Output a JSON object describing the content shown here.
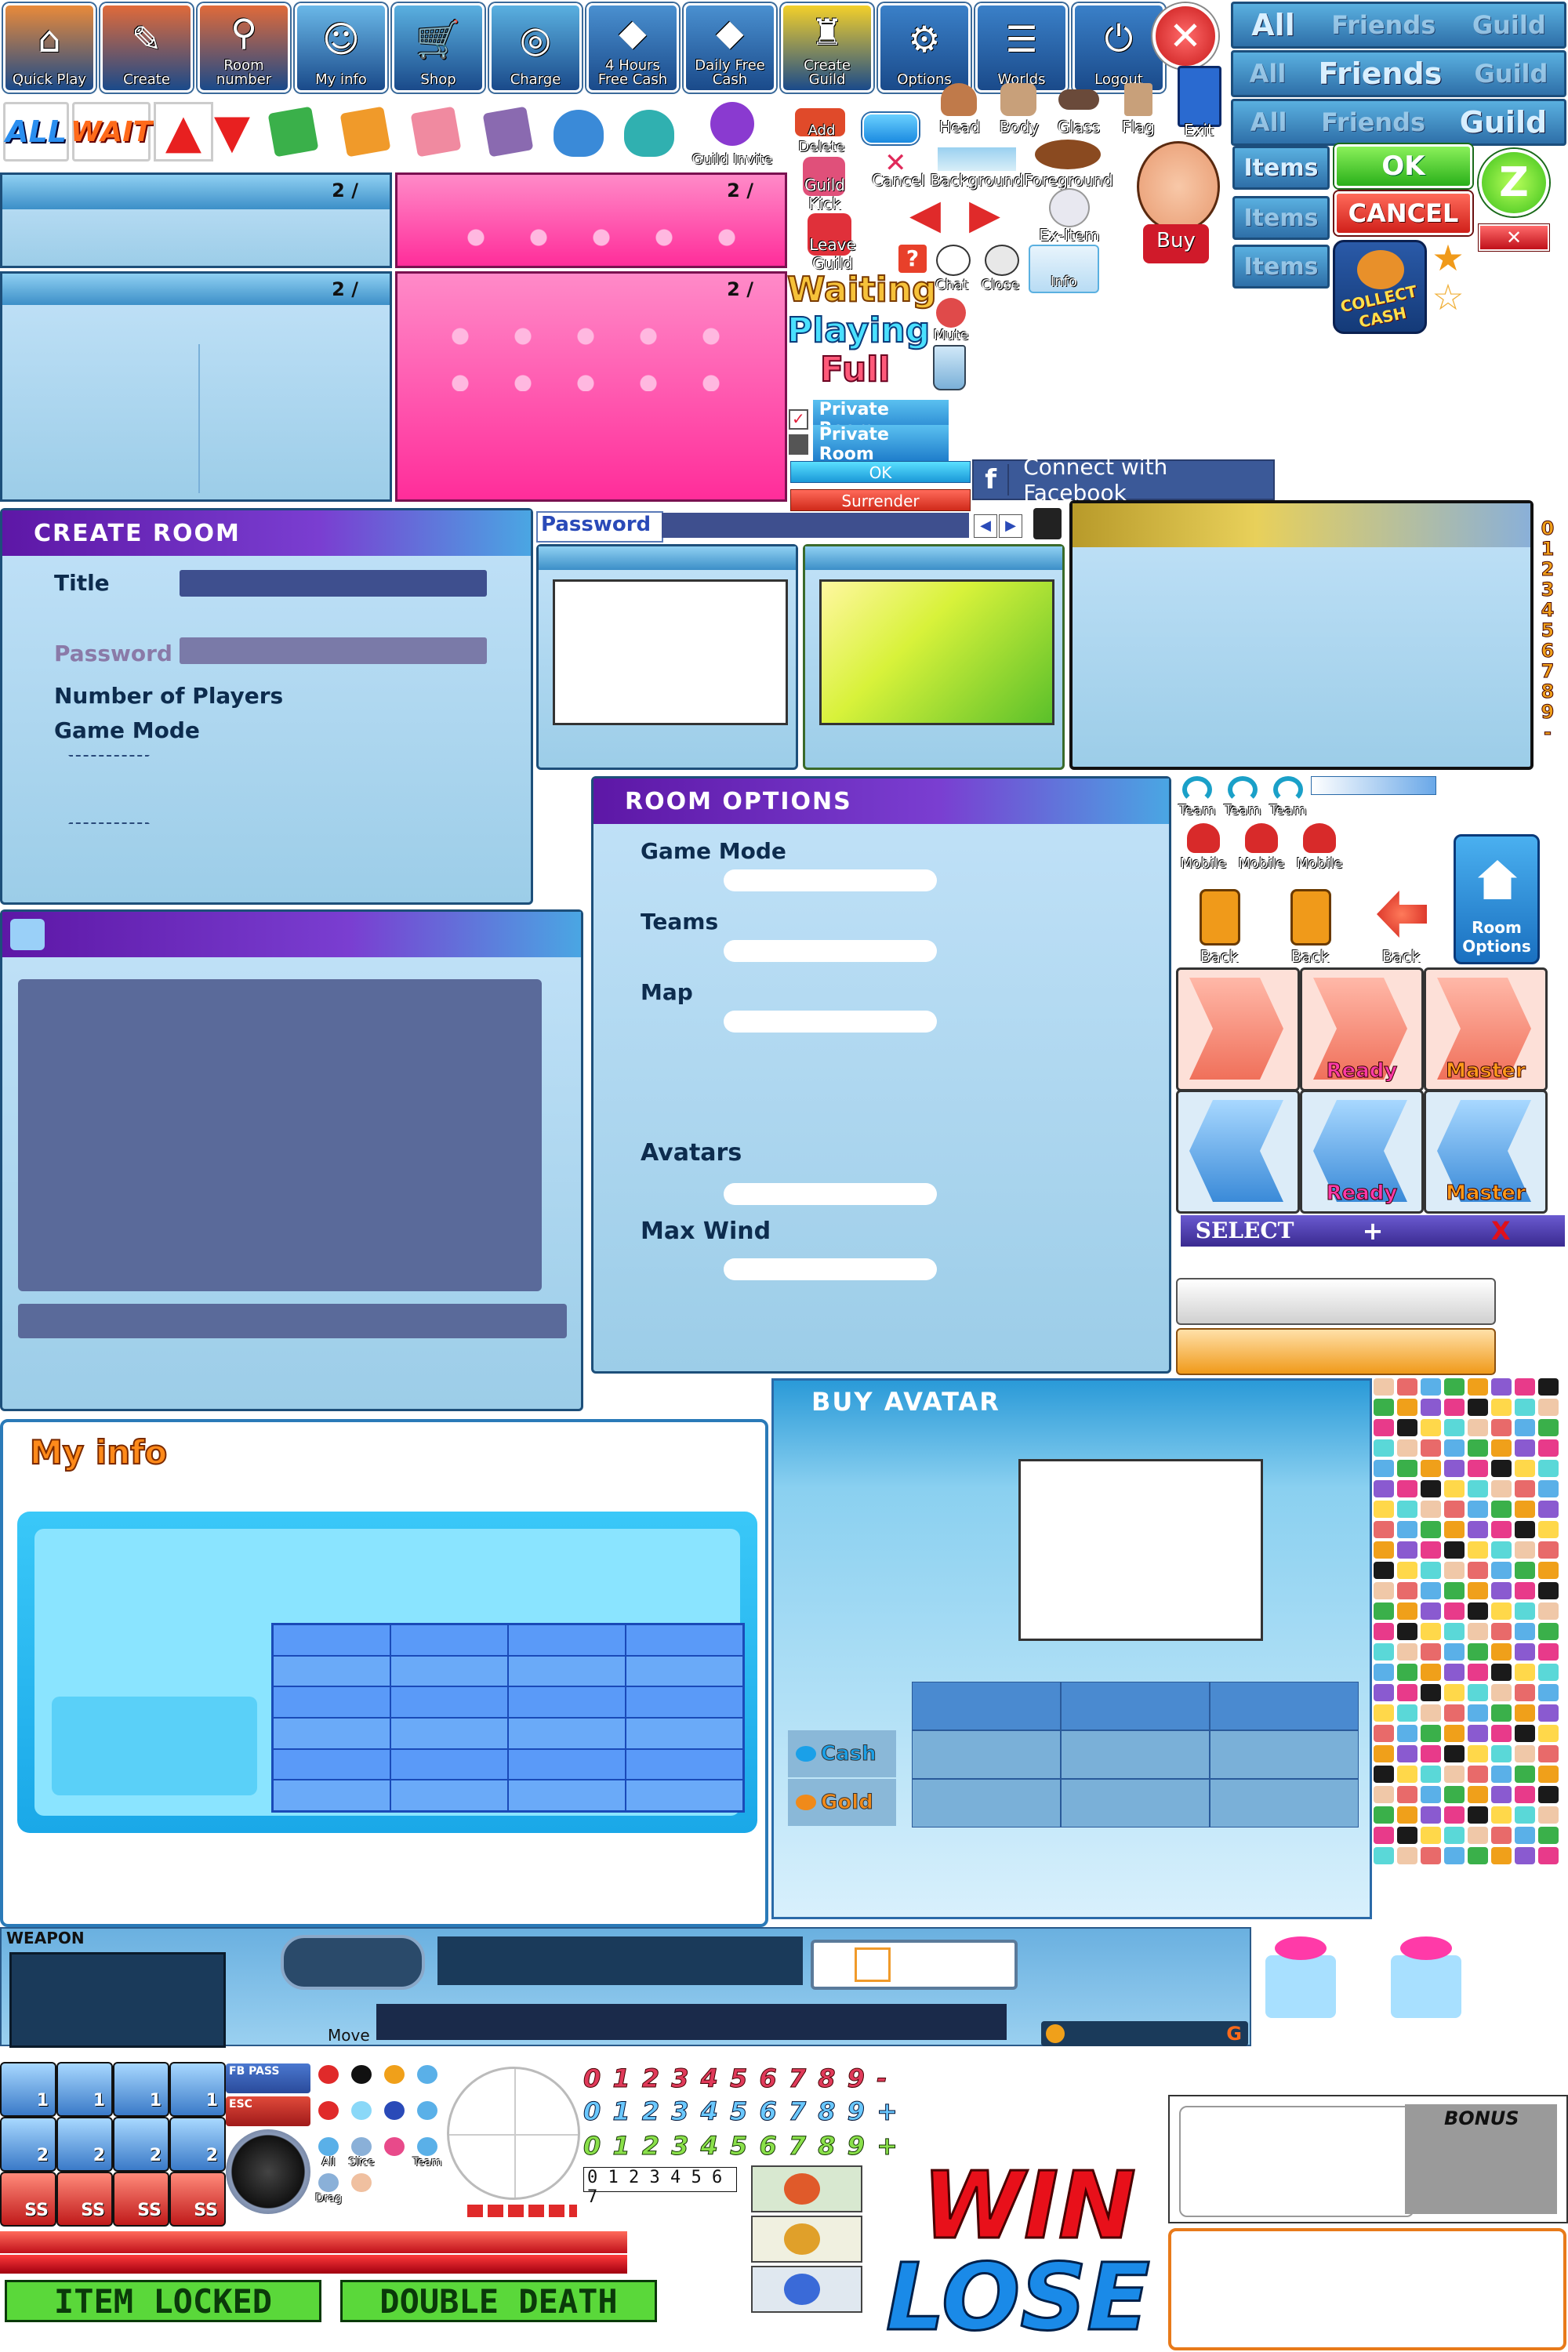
{
  "toolbar": [
    {
      "label": "Quick Play",
      "icon": "house-icon",
      "color": "#e98a3a"
    },
    {
      "label": "Create",
      "icon": "pencil-house-icon",
      "color": "#e06a3a"
    },
    {
      "label": "Room number",
      "icon": "magnifier-house-icon",
      "color": "#e06a3a"
    },
    {
      "label": "My info",
      "icon": "ghost-face-icon",
      "color": "#6ab8e8"
    },
    {
      "label": "Shop",
      "icon": "cart-icon",
      "color": "#5ab0e0"
    },
    {
      "label": "Charge",
      "icon": "coin-stack-icon",
      "color": "#5ab0e0"
    },
    {
      "label": "4 Hours Free Cash",
      "icon": "purple-monster-icon",
      "color": "#4a90d0"
    },
    {
      "label": "Daily Free Cash",
      "icon": "purple-monster-icon",
      "color": "#4a90d0"
    },
    {
      "label": "Create Guild",
      "icon": "guild-knight-icon",
      "color": "#f3d02a"
    },
    {
      "label": "Options",
      "icon": "gear-icon",
      "color": "#3a80c8"
    },
    {
      "label": "Worlds",
      "icon": "scroll-icon",
      "color": "#3a80c8"
    },
    {
      "label": "Logout",
      "icon": "power-icon",
      "color": "#3a80c8"
    }
  ],
  "close_symbol": "✕",
  "filter_row": {
    "all": "ALL",
    "wait": "WAIT"
  },
  "guild_invite": "Guild Invite",
  "add_delete": "Add Delete",
  "cancel": "Cancel",
  "background": "Background",
  "foreground": "Foreground",
  "head": "Head",
  "body": "Body",
  "glass": "Glass",
  "flag": "Flag",
  "exit": "Exit",
  "guild_kick": "Guild Kick",
  "leave_guild": "Leave Guild",
  "ex_item": "Ex-Item",
  "buy": "Buy",
  "chat": "Chat",
  "close": "Close",
  "info": "Info",
  "mute": "Mute",
  "status": {
    "waiting": "Waiting",
    "playing": "Playing",
    "full": "Full"
  },
  "private_room": "Private Room",
  "ok_small": "OK",
  "surrender": "Surrender",
  "facebook": "Connect with Facebook",
  "facebook_f": "f",
  "tabs": {
    "all": "All",
    "friends": "Friends",
    "guild": "Guild",
    "items": "Items"
  },
  "ok": "OK",
  "cancel_big": "CANCEL",
  "z": "Z",
  "collect_cash": "COLLECT CASH",
  "room_counter": "2 /",
  "create_room": {
    "title": "CREATE ROOM",
    "fields": [
      "Title",
      "Password",
      "Number of Players",
      "Game Mode"
    ]
  },
  "password_label": "Password",
  "room_options": {
    "title": "ROOM  OPTIONS",
    "fields": [
      "Game Mode",
      "Teams",
      "Map",
      "Avatars",
      "Max Wind"
    ]
  },
  "digits_column": [
    "0",
    "1",
    "2",
    "3",
    "4",
    "5",
    "6",
    "7",
    "8",
    "9",
    "-"
  ],
  "team": "Team",
  "mobile": "Mobile",
  "back": "Back",
  "room_options_btn": "Room Options",
  "ready": "Ready",
  "master": "Master",
  "select_bar": {
    "select": "SELECT",
    "plus": "+",
    "x": "X"
  },
  "my_info": "My info",
  "buy_avatar": {
    "title": "BUY AVATAR",
    "cash": "Cash",
    "gold": "Gold"
  },
  "weapon": "WEAPON",
  "move": "Move",
  "g_letter": "G",
  "slots": {
    "one": "1",
    "two": "2",
    "ss": "SS"
  },
  "fb_pass": "FB PASS",
  "esc": "ESC",
  "all_small": "All",
  "team_small": "Team",
  "slice": "Slice",
  "drag": "Drag",
  "digit_rows": [
    "0 1 2 3 4 5 6 7 8 9 -",
    "0 1 2 3 4 5 6 7 8 9 +",
    "0 1 2 3 4 5 6 7 8 9 +"
  ],
  "small_digits": "0 1 2 3 4 5 6 7",
  "win": "WIN",
  "lose": "LOSE",
  "bonus": "BONUS",
  "item_locked": "ITEM LOCKED",
  "double_death": "DOUBLE DEATH"
}
